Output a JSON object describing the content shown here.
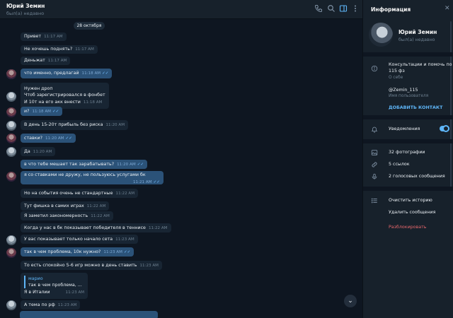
{
  "header": {
    "name": "Юрий Земин",
    "status": "был(а) недавно",
    "icons": [
      "phone-icon",
      "search-icon",
      "sidebar-toggle-icon",
      "more-vertical-icon"
    ]
  },
  "chat": {
    "date": "28 октября",
    "messages": [
      {
        "text": "Привет",
        "time": "11:17 AM",
        "own": false
      },
      {
        "text": "Не хочешь поднять?",
        "time": "11:17 AM",
        "own": false
      },
      {
        "text": "Деньжат",
        "time": "11:17 AM",
        "own": false
      },
      {
        "text": "что именно, предлагай",
        "time": "11:18 AM",
        "own": true
      },
      {
        "lines": [
          "Нужен дроп",
          "Чтоб зарегистрировался в фонбет",
          "И 10т на его акк внести"
        ],
        "time": "11:18 AM",
        "own": false
      },
      {
        "text": "и?",
        "time": "11:18 AM",
        "own": true
      },
      {
        "text": "В день 15-20т прибыль без риска",
        "time": "11:20 AM",
        "own": false
      },
      {
        "text": "ставки?",
        "time": "11:20 AM",
        "own": true
      },
      {
        "text": "Да",
        "time": "11:20 AM",
        "own": false
      },
      {
        "text": "в что тебе мешает так зарабатывать?",
        "time": "11:20 AM",
        "own": true
      },
      {
        "text": "я со ставками не дружу, не пользуюсь услугами бк",
        "time": "11:21 AM",
        "own": true
      },
      {
        "text": "Но на события очень не стандартные",
        "time": "11:22 AM",
        "own": false
      },
      {
        "text": "Тут фишка в самих играх",
        "time": "11:22 AM",
        "own": false
      },
      {
        "text": "Я заметил закономерность",
        "time": "11:22 AM",
        "own": false
      },
      {
        "text": "Когда у нас в бк показывает победителя в теннисе",
        "time": "11:22 AM",
        "own": false
      },
      {
        "text": "У вас показывает только начало сета",
        "time": "11:23 AM",
        "own": false
      },
      {
        "text": "так в чем проблема, 10к нужно?",
        "time": "11:23 AM",
        "own": true
      },
      {
        "text": "То есть спокойно 5-6 игр можно в день ставить",
        "time": "11:23 AM",
        "own": false
      },
      {
        "reply_name": "марио",
        "reply_text": "так в чем проблема, ...",
        "text": "Я в Италии",
        "time": "11:23 AM",
        "own": false
      },
      {
        "text": "А тема по рф",
        "time": "11:23 AM",
        "own": false
      }
    ],
    "read_ticks": "✓✓",
    "scroll_down_glyph": "⌄"
  },
  "info": {
    "title": "Информация",
    "close_glyph": "✕",
    "name": "Юрий Земин",
    "status": "был(а) недавно",
    "bio_line1": "Консультации и помочь по",
    "bio_line2": "115 фз",
    "bio_label": "О себе",
    "username": "@Zemin_115",
    "username_label": "Имя пользователя",
    "add_contact": "ДОБАВИТЬ КОНТАКТ",
    "notifications": "Уведомления",
    "notifications_on": true,
    "photos": "32 фотографии",
    "links": "5 ссылок",
    "voice": "2 голосовых сообщения",
    "clear_history": "Очистить историю",
    "delete_chat": "Удалить сообщения",
    "unblock": "Разблокировать"
  }
}
